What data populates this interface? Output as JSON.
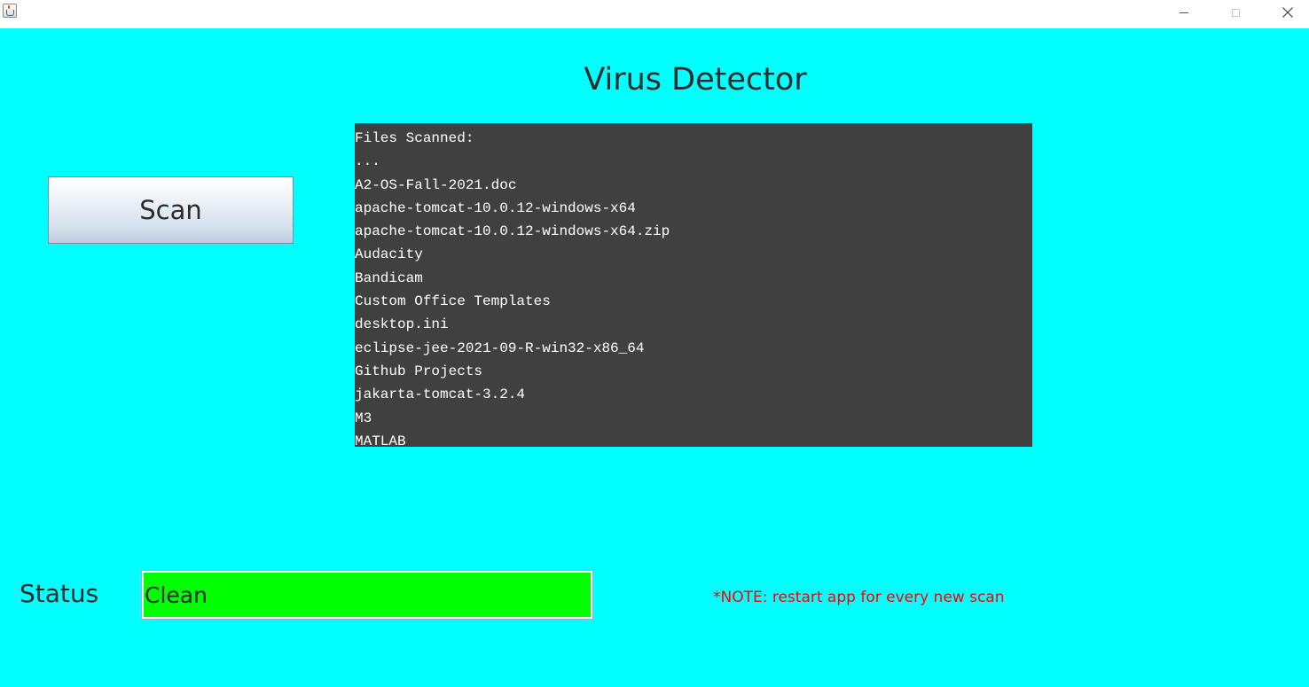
{
  "window": {
    "icon": "java-cup-icon",
    "controls": [
      "minimize-icon",
      "maximize-icon",
      "close-icon"
    ]
  },
  "app": {
    "title": "Virus Detector"
  },
  "scan_button": {
    "label": "Scan"
  },
  "scan_output": {
    "lines": [
      "Files Scanned:",
      "...",
      "A2-OS-Fall-2021.doc",
      "apache-tomcat-10.0.12-windows-x64",
      "apache-tomcat-10.0.12-windows-x64.zip",
      "Audacity",
      "Bandicam",
      "Custom Office Templates",
      "desktop.ini",
      "eclipse-jee-2021-09-R-win32-x86_64",
      "Github Projects",
      "jakarta-tomcat-3.2.4",
      "M3",
      "MATLAB"
    ]
  },
  "status": {
    "label": "Status",
    "value": "Clean",
    "value_color": "#00ff00"
  },
  "note": "*NOTE: restart app for every new scan",
  "colors": {
    "background": "#00ffff",
    "output_background": "#404040",
    "note": "#ff0000"
  }
}
